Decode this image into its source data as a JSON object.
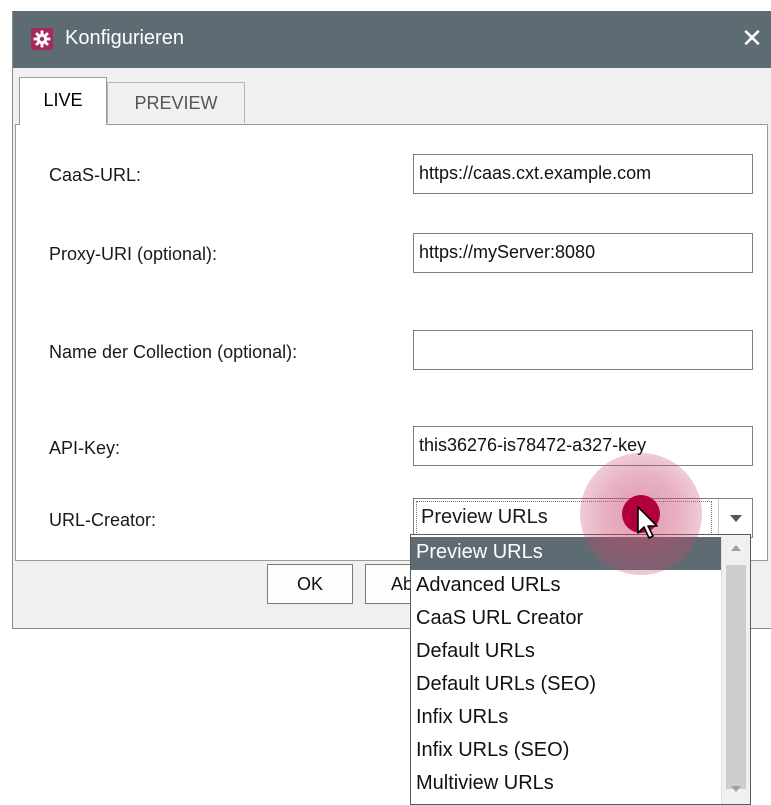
{
  "window": {
    "title": "Konfigurieren",
    "close_glyph": "✕",
    "app_icon": "gear-icon",
    "accent_color": "#a8285e",
    "titlebar_color": "#5d6b73"
  },
  "tabs": [
    {
      "label": "LIVE",
      "active": true
    },
    {
      "label": "PREVIEW",
      "active": false
    }
  ],
  "form": {
    "caas_url": {
      "label": "CaaS-URL:",
      "value": "https://caas.cxt.example.com"
    },
    "proxy_uri": {
      "label": "Proxy-URI (optional):",
      "value": "https://myServer:8080"
    },
    "collection": {
      "label": "Name der Collection (optional):",
      "value": ""
    },
    "api_key": {
      "label": "API-Key:",
      "value": "this36276-is78472-a327-key"
    },
    "url_creator": {
      "label": "URL-Creator:",
      "selected": "Preview URLs"
    }
  },
  "buttons": {
    "ok_label": "OK",
    "abort_label": "Ab"
  },
  "dropdown": {
    "options": [
      "Preview URLs",
      "Advanced URLs",
      "CaaS URL Creator",
      "Default URLs",
      "Default URLs (SEO)",
      "Infix URLs",
      "Infix URLs (SEO)",
      "Multiview URLs"
    ],
    "selected_index": 0,
    "selected_color": "#5f6b72"
  }
}
